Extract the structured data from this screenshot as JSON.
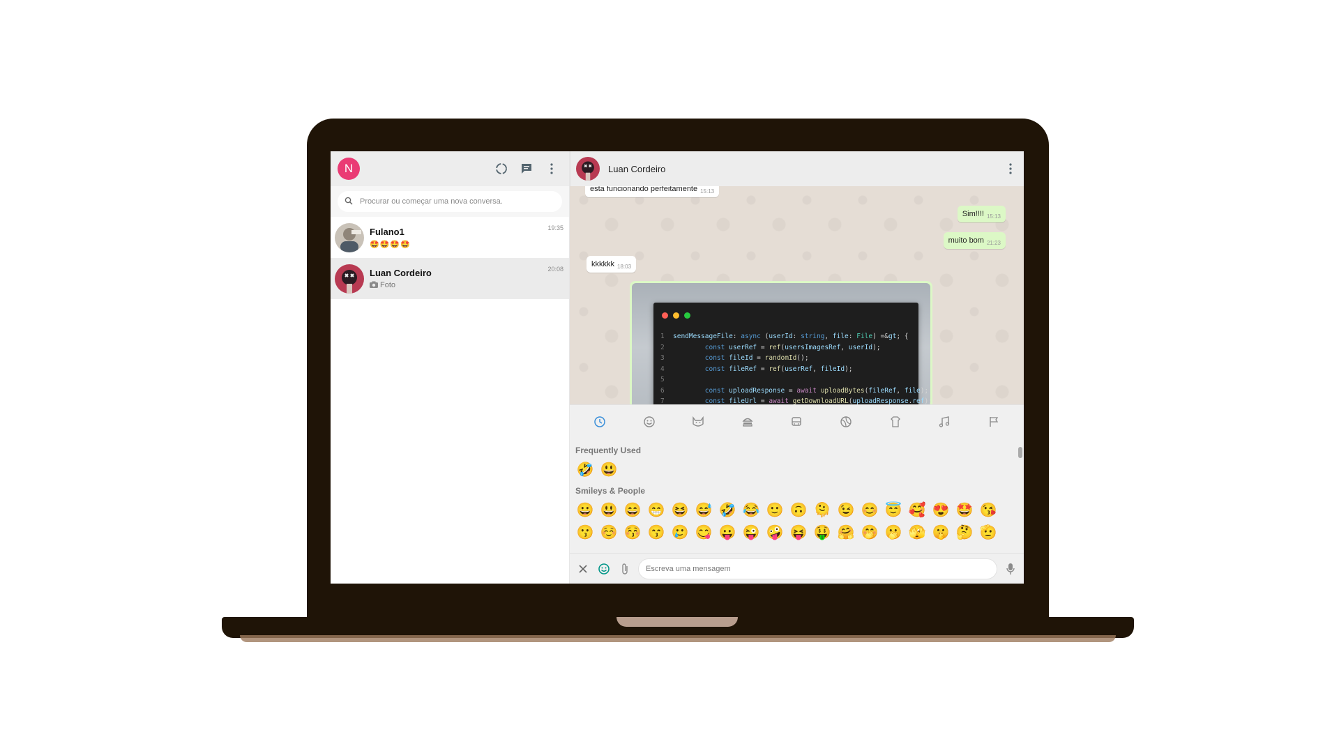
{
  "colors": {
    "laptop_body": "#1f1407",
    "accent_avatar": "#ea3b74",
    "chat_background": "#e5ddd5",
    "outgoing_bubble": "#dcf8c6",
    "incoming_bubble": "#ffffff"
  },
  "sidebar": {
    "user_initial": "N",
    "header_icons": [
      "status-icon",
      "new-chat-icon",
      "menu-icon"
    ],
    "search": {
      "placeholder": "Procurar ou começar uma nova conversa."
    },
    "chats": [
      {
        "name": "Fulano1",
        "preview": "🤩🤩🤩🤩",
        "time": "19:35",
        "active": false
      },
      {
        "name": "Luan Cordeiro",
        "preview": "Foto",
        "preview_icon": "camera-icon",
        "time": "20:08",
        "active": true
      }
    ]
  },
  "conversation": {
    "contact_name": "Luan Cordeiro",
    "messages": [
      {
        "text": "esta funcionando perfeitamente",
        "time": "15:13",
        "direction": "in"
      },
      {
        "text": "Sim!!!!",
        "time": "15:13",
        "direction": "out"
      },
      {
        "text": "muito bom",
        "time": "21:23",
        "direction": "out"
      },
      {
        "text": "kkkkkk",
        "time": "18:03",
        "direction": "in"
      }
    ],
    "code_image": {
      "lines": [
        {
          "n": "1",
          "code": "sendMessageFile: async (userId: string, file: File) => {"
        },
        {
          "n": "2",
          "code": "        const userRef = ref(usersImagesRef, userId);"
        },
        {
          "n": "3",
          "code": "        const fileId = randomId();"
        },
        {
          "n": "4",
          "code": "        const fileRef = ref(userRef, fileId);"
        },
        {
          "n": "5",
          "code": ""
        },
        {
          "n": "6",
          "code": "        const uploadResponse = await uploadBytes(fileRef, file);"
        },
        {
          "n": "7",
          "code": "        const fileUrl = await getDownloadURL(uploadResponse.ref);"
        }
      ]
    }
  },
  "emoji_picker": {
    "categories": [
      "recent-icon",
      "smiley-icon",
      "animal-icon",
      "food-icon",
      "travel-icon",
      "activity-icon",
      "objects-icon",
      "symbols-icon",
      "flag-icon"
    ],
    "active_category": "recent-icon",
    "frequently_used_title": "Frequently Used",
    "frequently_used": [
      "🤣",
      "😃"
    ],
    "smileys_title": "Smileys & People",
    "smileys_row1": [
      "😀",
      "😃",
      "😄",
      "😁",
      "😆",
      "😅",
      "🤣",
      "😂",
      "🙂",
      "🙃",
      "🫠",
      "😉",
      "😊",
      "😇",
      "🥰",
      "😍",
      "🤩",
      "😘"
    ],
    "smileys_row2": [
      "😗",
      "☺️",
      "😚",
      "😙",
      "🥲",
      "😋",
      "😛",
      "😜",
      "🤪",
      "😝",
      "🤑",
      "🤗",
      "🤭",
      "🫢",
      "🫣",
      "🤫",
      "🤔",
      "🫡"
    ]
  },
  "composer": {
    "placeholder": "Escreva uma mensagem"
  }
}
